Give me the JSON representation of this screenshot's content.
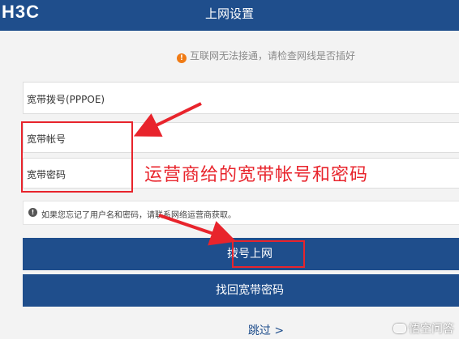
{
  "header": {
    "logo": "H3C",
    "title": "上网设置"
  },
  "notice": {
    "text": "互联网无法接通，请检查网线是否插好",
    "icon": "warning-icon"
  },
  "form": {
    "mode_label": "宽带拨号(PPPOE)",
    "account_label": "宽带帐号",
    "password_label": "宽带密码"
  },
  "annotation": {
    "text": "运营商给的宽带帐号和密码"
  },
  "hint": {
    "text": "如果您忘记了用户名和密码，请联系网络运营商获取。",
    "icon": "info-icon"
  },
  "buttons": {
    "dial_label": "拨号上网",
    "recover_label": "找回宽带密码",
    "skip_label": "跳过 >"
  },
  "watermark": {
    "text": "悟空问答"
  },
  "colors": {
    "header_bg": "#1f4e8c",
    "button_bg": "#1f4e8c",
    "annotation_red": "#e8242c",
    "warning_orange": "#f07b15"
  }
}
